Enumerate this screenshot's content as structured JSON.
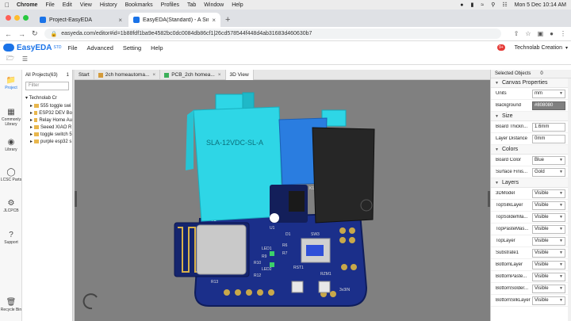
{
  "os": {
    "app_name": "Chrome",
    "menu": [
      "File",
      "Edit",
      "View",
      "History",
      "Bookmarks",
      "Profiles",
      "Tab",
      "Window",
      "Help"
    ],
    "clock": "Mon 5 Dec 10:14 AM"
  },
  "browser": {
    "tabs": [
      {
        "title": "Project-EasyEDA",
        "active": false
      },
      {
        "title": "EasyEDA(Standard) - A Simple...",
        "active": true
      }
    ],
    "url": "easyeda.com/editor#id=1b88fdf1ba9e4582bc0dc0084db86cf1|26cd578544f448d4ab31683d460630b7"
  },
  "editor": {
    "brand": "EasyEDA",
    "edition": "STD",
    "menu": [
      "File",
      "Advanced",
      "Setting",
      "Help"
    ],
    "notification_count": "9+",
    "user_name": "Technolab Creation",
    "left_nav": [
      {
        "label": "Project",
        "icon": "folder-icon"
      },
      {
        "label": "Commonly Library",
        "icon": "chip-icon"
      },
      {
        "label": "Library",
        "icon": "library-icon"
      },
      {
        "label": "LCSC Parts",
        "icon": "lcsc-icon"
      },
      {
        "label": "JLCPCB",
        "icon": "jlcpcb-icon"
      },
      {
        "label": "Support",
        "icon": "support-icon"
      },
      {
        "label": "Recycle Bin",
        "icon": "trash-icon"
      }
    ],
    "projects": {
      "header": "All Projects(63)",
      "count": "1",
      "filter_placeholder": "Filter",
      "root": "Technolab Cr",
      "items": [
        "555 toggle swi",
        "ESP32 DEV Bo",
        "Relay Home Au",
        "Seeed XIAO R",
        "toggle switch 5",
        "purple esp32 s"
      ]
    },
    "doc_tabs": [
      {
        "label": "Start",
        "kind": "start"
      },
      {
        "label": "2ch homeautoma...",
        "kind": "schematic"
      },
      {
        "label": "PCB_2ch homea...",
        "kind": "pcb"
      },
      {
        "label": "3D View",
        "kind": "3d"
      }
    ],
    "board_labels": {
      "relay_text": "SLA-12VDC-SL-A",
      "u1": "U1",
      "esp": "ESP32",
      "sw3": "SW3",
      "rst1": "RST1",
      "k1": "K1",
      "d1": "D1",
      "led1": "LED1",
      "led2": "LED2",
      "r6": "R6",
      "r7": "R7",
      "r9": "R9",
      "r10": "R10",
      "r12": "R12",
      "r13": "R13",
      "rzm1": "RZM1",
      "v3": "3v3IN"
    },
    "properties": {
      "selected_label": "Selected Objects",
      "selected_count": "0",
      "canvas": {
        "title": "Canvas Properties",
        "units_label": "Units",
        "units_value": "mm",
        "background_label": "Background",
        "background_value": "#808080"
      },
      "size": {
        "title": "Size",
        "thickness_label": "Board Thickn...",
        "thickness_value": "1.6mm",
        "layer_distance_label": "Layer Distance",
        "layer_distance_value": "0mm"
      },
      "colors": {
        "title": "Colors",
        "board_color_label": "Board Color",
        "board_color_value": "Blue",
        "surface_label": "Surface Finis...",
        "surface_value": "Gold"
      },
      "layers": {
        "title": "Layers",
        "rows": [
          {
            "label": "3DModel",
            "value": "Visible"
          },
          {
            "label": "TopSilkLayer",
            "value": "Visible"
          },
          {
            "label": "TopSolderMa...",
            "value": "Visible"
          },
          {
            "label": "TopPasteMas...",
            "value": "Visible"
          },
          {
            "label": "TopLayer",
            "value": "Visible"
          },
          {
            "label": "Substrate1",
            "value": "Visible"
          },
          {
            "label": "BottomLayer",
            "value": "Visible"
          },
          {
            "label": "BottomPaste...",
            "value": "Visible"
          },
          {
            "label": "BottomSolder...",
            "value": "Visible"
          },
          {
            "label": "BottomSilkLayer",
            "value": "Visible"
          }
        ]
      }
    }
  },
  "colors": {
    "board": "#1b2f8a",
    "terminal": "#2ed6e6",
    "relay": "#222222",
    "viewport_bg": "#808080",
    "accent": "#1a73e8"
  }
}
